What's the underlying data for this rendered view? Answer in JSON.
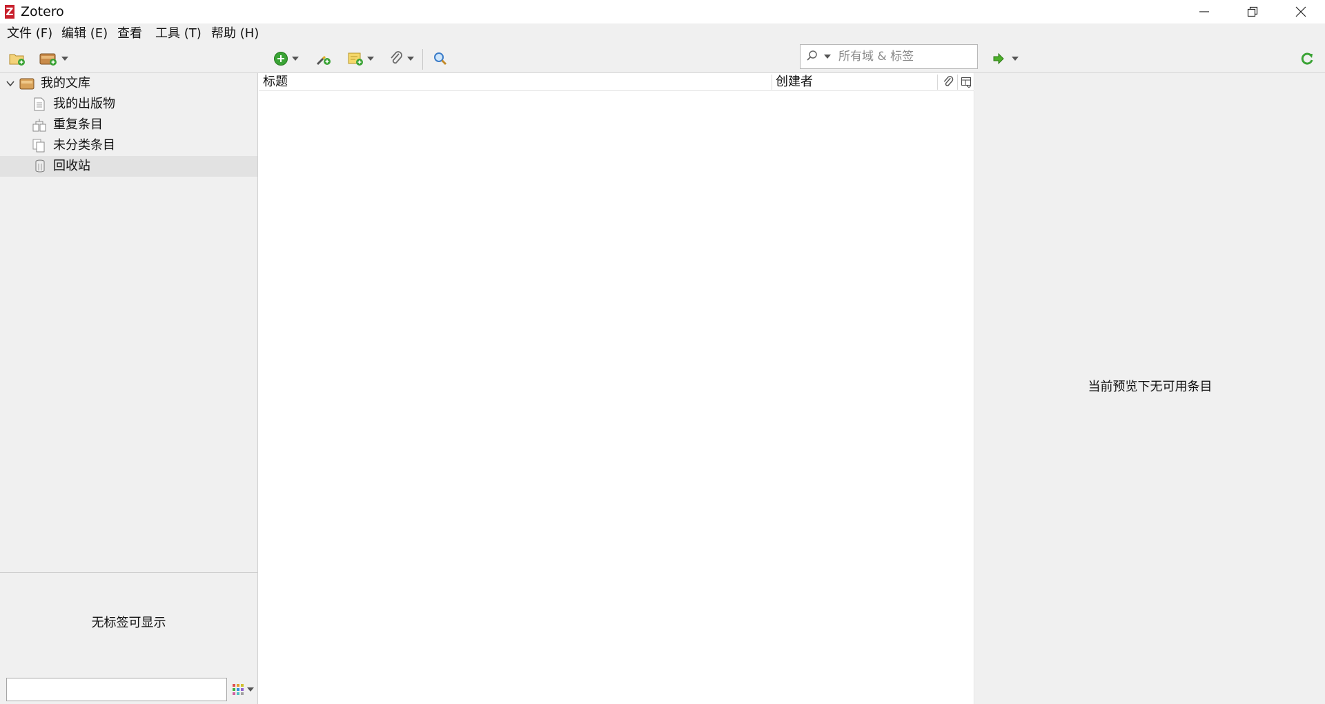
{
  "window": {
    "title": "Zotero",
    "logo_letter": "Z"
  },
  "menu": [
    {
      "label": "文件 (F)"
    },
    {
      "label": "编辑 (E)"
    },
    {
      "label": "查看"
    },
    {
      "label": "工具 (T)"
    },
    {
      "label": "帮助 (H)"
    }
  ],
  "search": {
    "placeholder": "所有域 & 标签"
  },
  "collections": [
    {
      "label": "我的文库",
      "icon": "library-icon",
      "expanded": true
    },
    {
      "label": "我的出版物",
      "icon": "publications-icon"
    },
    {
      "label": "重复条目",
      "icon": "duplicates-icon"
    },
    {
      "label": "未分类条目",
      "icon": "unfiled-icon"
    },
    {
      "label": "回收站",
      "icon": "trash-icon",
      "selected": true
    }
  ],
  "tags": {
    "empty_message": "无标签可显示",
    "filter_value": ""
  },
  "items": {
    "columns": [
      {
        "label": "标题"
      },
      {
        "label": "创建者"
      }
    ]
  },
  "item_pane": {
    "empty_message": "当前预览下无可用条目"
  },
  "colors": {
    "accent_green": "#3aa335",
    "logo_red": "#c8202c",
    "folder_tan": "#d8a25a",
    "selection": "#e2e2e2"
  }
}
